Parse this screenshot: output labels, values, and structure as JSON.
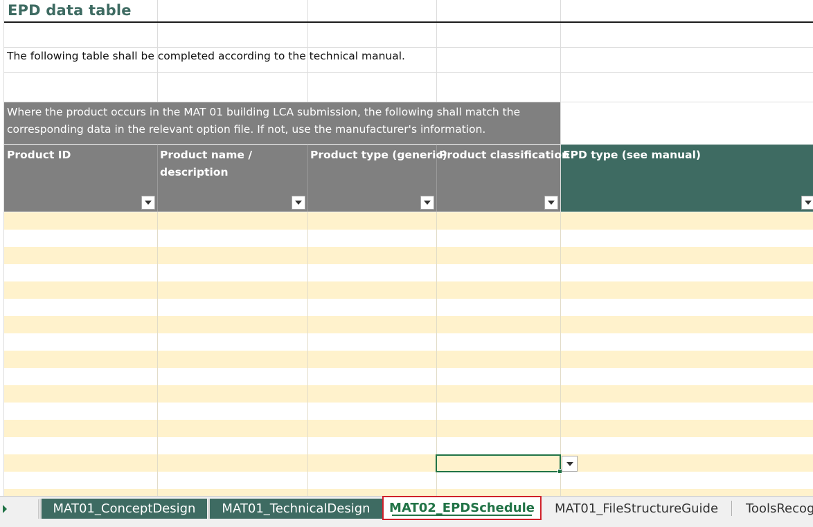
{
  "sheet": {
    "title": "EPD data table",
    "intro": "The following table shall be completed according to the technical manual.",
    "note": "Where the product occurs in the MAT 01 building LCA submission, the following shall match the corresponding data in the relevant option file. If not, use the manufacturer's information.",
    "headers": [
      {
        "label": "Product ID"
      },
      {
        "label": "Product name / description"
      },
      {
        "label": "Product type (generic)"
      },
      {
        "label": "Product classification"
      },
      {
        "label": "EPD type (see manual)"
      }
    ]
  },
  "tabs": [
    {
      "label": "MAT01_ConceptDesign",
      "state": "normal"
    },
    {
      "label": "MAT01_TechnicalDesign",
      "state": "normal"
    },
    {
      "label": "MAT02_EPDSchedule",
      "state": "active"
    },
    {
      "label": "MAT01_FileStructureGuide",
      "state": "plain"
    },
    {
      "label": "ToolsRecog",
      "state": "plain"
    }
  ],
  "colors": {
    "header_grey": "#808080",
    "header_green": "#3e6b62",
    "band": "#fff2cc",
    "title": "#3e6b62",
    "excel_green": "#217346",
    "active_tab_border": "#d0202a"
  },
  "icons": {
    "filter_dropdown": "chevron-down-icon",
    "sheet_scroll": "play-right-icon"
  }
}
